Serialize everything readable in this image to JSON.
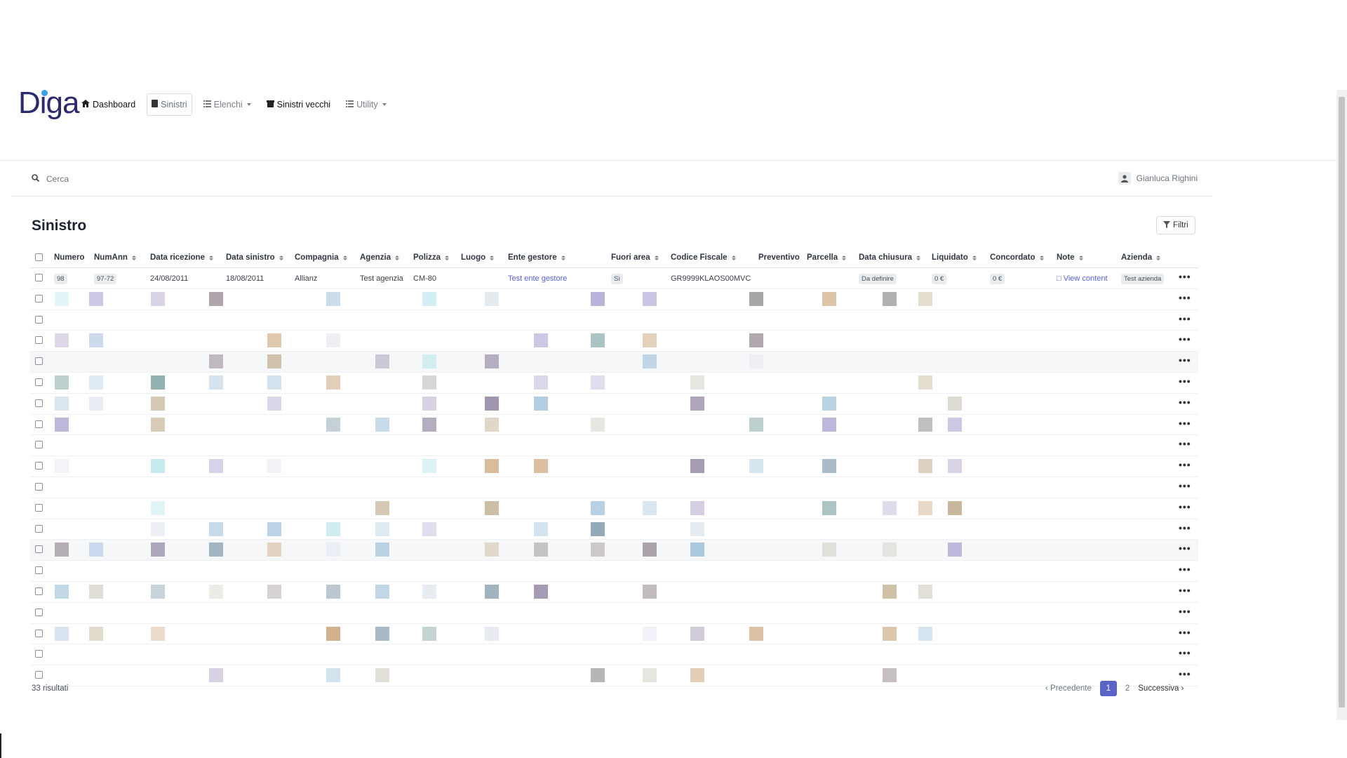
{
  "app": {
    "logo": "Diga",
    "nav": [
      {
        "label": "Dashboard",
        "icon": "home-icon"
      },
      {
        "label": "Sinistri",
        "icon": "document-icon"
      },
      {
        "label": "Elenchi",
        "icon": "list-icon"
      },
      {
        "label": "Sinistri vecchi",
        "icon": "archive-icon"
      },
      {
        "label": "Utility",
        "icon": "list-icon"
      }
    ]
  },
  "search": {
    "placeholder": "Cerca"
  },
  "user": {
    "name": "Gianluca Righini"
  },
  "page": {
    "title": "Sinistro",
    "filter_label": "Filtri"
  },
  "table": {
    "columns": [
      "Numero",
      "NumAnn",
      "Data ricezione",
      "Data sinistro",
      "Compagnia",
      "Agenzia",
      "Polizza",
      "Luogo",
      "Ente gestore",
      "Fuori area",
      "Codice Fiscale",
      "Preventivo",
      "Parcella",
      "Data chiusura",
      "Liquidato",
      "Concordato",
      "Note",
      "Azienda"
    ],
    "first_row": {
      "numero": "98",
      "numann": "97-72",
      "data_ricezione": "24/08/2011",
      "data_sinistro": "18/08/2011",
      "compagnia": "Allianz",
      "agenzia": "Test agenzia",
      "polizza": "CM-80",
      "luogo": "",
      "ente_gestore": "Test ente gestore",
      "fuori_area": "Sì",
      "codice_fiscale": "GR9999KLAOS00MVC",
      "preventivo": "",
      "parcella": "",
      "data_chiusura": "Da definire",
      "liquidato": "0 €",
      "concordato": "0 €",
      "note": "View content",
      "azienda": "Test azienda"
    },
    "row_action": "•••"
  },
  "footer": {
    "count": "33 risultati",
    "prev": "Precedente",
    "pages": [
      "1",
      "2"
    ],
    "next": "Successiva"
  }
}
